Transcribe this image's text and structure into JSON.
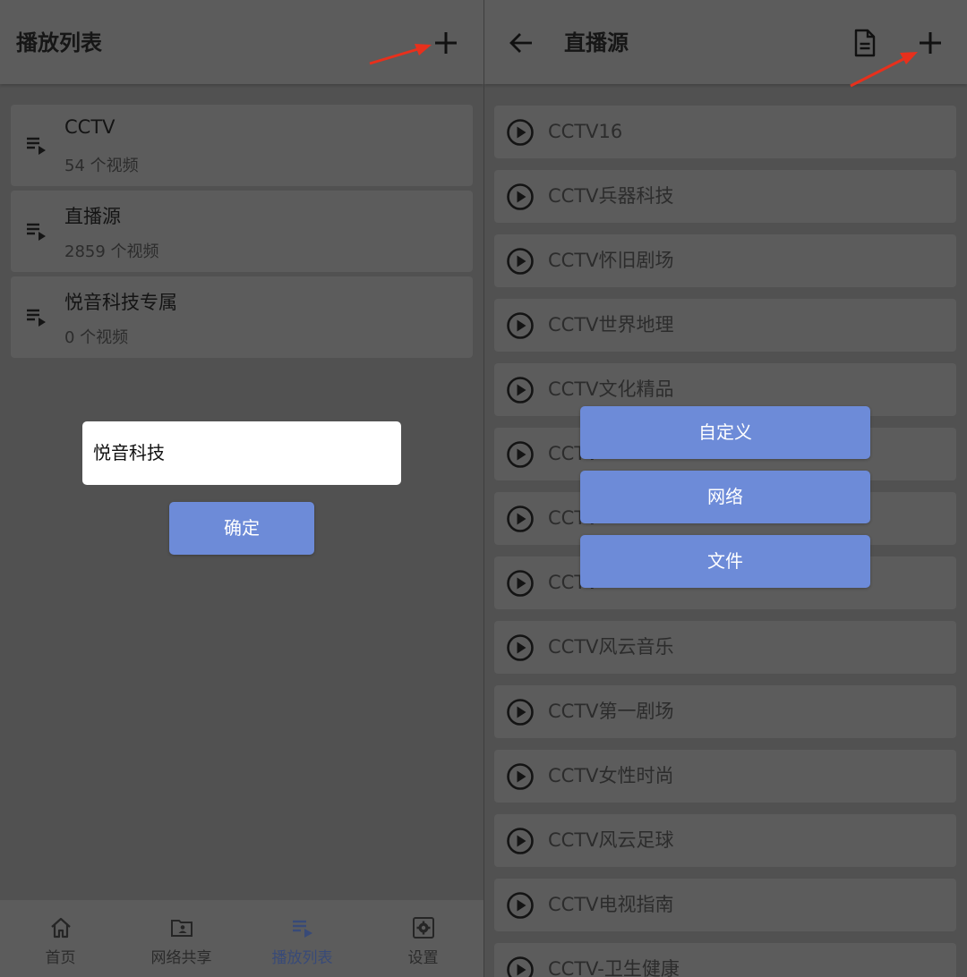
{
  "left": {
    "title": "播放列表",
    "playlists": [
      {
        "title": "CCTV",
        "count": "54 个视频"
      },
      {
        "title": "直播源",
        "count": "2859 个视频"
      },
      {
        "title": "悦音科技专属",
        "count": "0 个视频"
      }
    ],
    "dialog": {
      "input_value": "悦音科技",
      "confirm_label": "确定"
    },
    "bottom_nav": [
      {
        "label": "首页",
        "icon": "home-icon"
      },
      {
        "label": "网络共享",
        "icon": "shared-folder-icon"
      },
      {
        "label": "播放列表",
        "icon": "playlist-icon",
        "active": true
      },
      {
        "label": "设置",
        "icon": "settings-icon"
      }
    ]
  },
  "right": {
    "title": "直播源",
    "channels": [
      "CCTV16",
      "CCTV兵器科技",
      "CCTV怀旧剧场",
      "CCTV世界地理",
      "CCTV文化精品",
      "CCTV",
      "CCTV",
      "CCTV",
      "CCTV风云音乐",
      "CCTV第一剧场",
      "CCTV女性时尚",
      "CCTV风云足球",
      "CCTV电视指南",
      "CCTV-卫生健康"
    ],
    "menu": [
      "自定义",
      "网络",
      "文件"
    ]
  },
  "colors": {
    "accent": "#6d8bd8",
    "annotation_arrow": "#e8301c",
    "active_nav": "#384a78"
  }
}
